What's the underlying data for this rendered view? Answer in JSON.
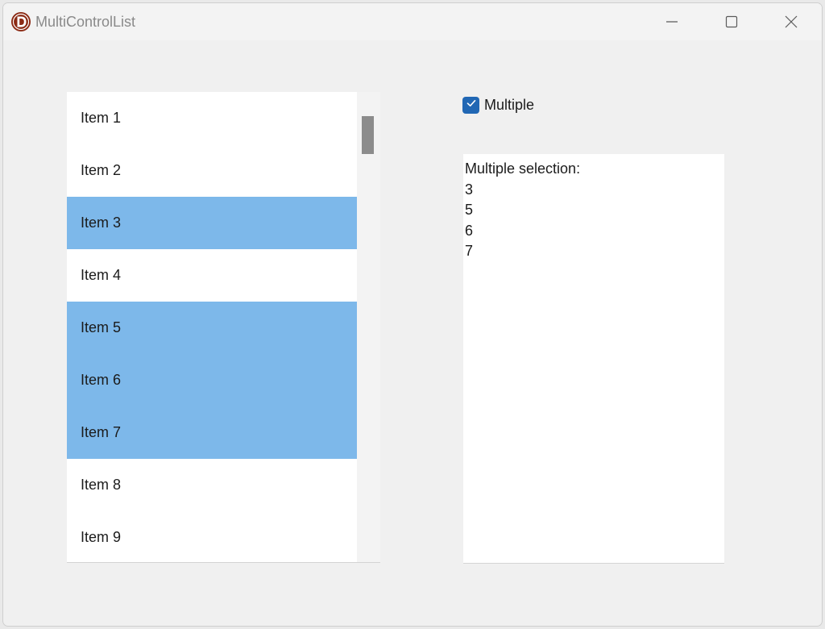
{
  "window": {
    "title": "MultiControlList",
    "icon": "d-logo-icon",
    "controls": [
      "minimize-icon",
      "maximize-icon",
      "close-icon"
    ]
  },
  "list": {
    "items": [
      {
        "label": "Item 1",
        "selected": false
      },
      {
        "label": "Item 2",
        "selected": false
      },
      {
        "label": "Item 3",
        "selected": true
      },
      {
        "label": "Item 4",
        "selected": false
      },
      {
        "label": "Item 5",
        "selected": true
      },
      {
        "label": "Item 6",
        "selected": true
      },
      {
        "label": "Item 7",
        "selected": true
      },
      {
        "label": "Item 8",
        "selected": false
      },
      {
        "label": "Item 9",
        "selected": false
      }
    ]
  },
  "options": {
    "multiple_label": "Multiple",
    "multiple_checked": true
  },
  "output": {
    "lines": [
      "Multiple selection:",
      "3",
      "5",
      "6",
      "7"
    ]
  },
  "colors": {
    "selection": "#7db8ea",
    "checkbox": "#2167b4",
    "logo": "#8b2a14"
  }
}
